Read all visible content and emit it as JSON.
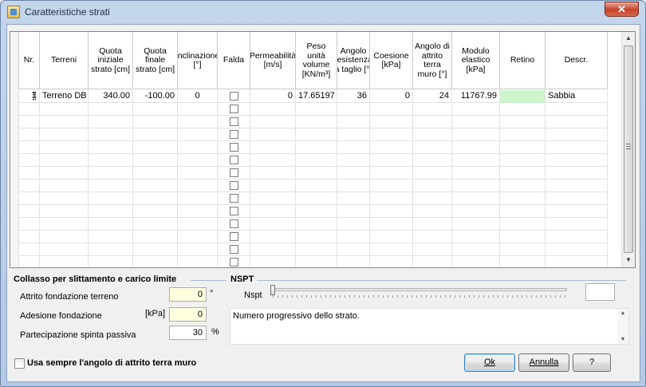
{
  "window": {
    "title": "Caratteristiche strati",
    "close_label": "✕"
  },
  "table": {
    "columns": [
      {
        "key": "selector",
        "label": ""
      },
      {
        "key": "nr",
        "label": "Nr."
      },
      {
        "key": "terreni",
        "label": "Terreni"
      },
      {
        "key": "quota_iniziale",
        "label": "Quota iniziale strato [cm]"
      },
      {
        "key": "quota_finale",
        "label": "Quota finale strato [cm]"
      },
      {
        "key": "inclinazione",
        "label": "Inclinazione [°]"
      },
      {
        "key": "falda",
        "label": "Falda"
      },
      {
        "key": "permeabilita",
        "label": "Permeabilità [m/s]"
      },
      {
        "key": "peso",
        "label": "Peso unità volume [KN/m³]"
      },
      {
        "key": "angolo_resistenza",
        "label": "Angolo resistenza a taglio [°]"
      },
      {
        "key": "coesione",
        "label": "Coesione [kPa]"
      },
      {
        "key": "angolo_attrito",
        "label": "Angolo di attrito terra muro [°]"
      },
      {
        "key": "modulo",
        "label": "Modulo elastico [kPa]"
      },
      {
        "key": "retino",
        "label": "Retino"
      },
      {
        "key": "descr",
        "label": "Descr."
      }
    ],
    "rows": [
      {
        "nr": "1",
        "terreni": "Terreno DB",
        "quota_iniziale": "340.00",
        "quota_finale": "-100.00",
        "inclinazione": "0",
        "falda": false,
        "permeabilita": "0",
        "peso": "17.65197",
        "angolo_resistenza": "36",
        "coesione": "0",
        "angolo_attrito": "24",
        "modulo": "11767.99",
        "retino": "",
        "descr": "Sabbia"
      }
    ],
    "empty_rows": 15
  },
  "collasso": {
    "title": "Collasso per slittamento e carico limite",
    "attrito_label": "Attrito fondazione terreno",
    "attrito_value": "0",
    "attrito_unit": "°",
    "adesione_label": "Adesione fondazione",
    "adesione_unit": "[kPa]",
    "adesione_value": "0",
    "partecipazione_label": "Partecipazione spinta passiva",
    "partecipazione_value": "30",
    "partecipazione_unit": "%"
  },
  "nspt": {
    "title": "NSPT",
    "slider_label": "Nspt",
    "value": ""
  },
  "description_text": "Numero progressivo dello strato.",
  "checkbox_label": "Usa sempre l'angolo di attrito terra muro",
  "buttons": {
    "ok": "Ok",
    "annulla": "Annulla",
    "help": "?"
  }
}
